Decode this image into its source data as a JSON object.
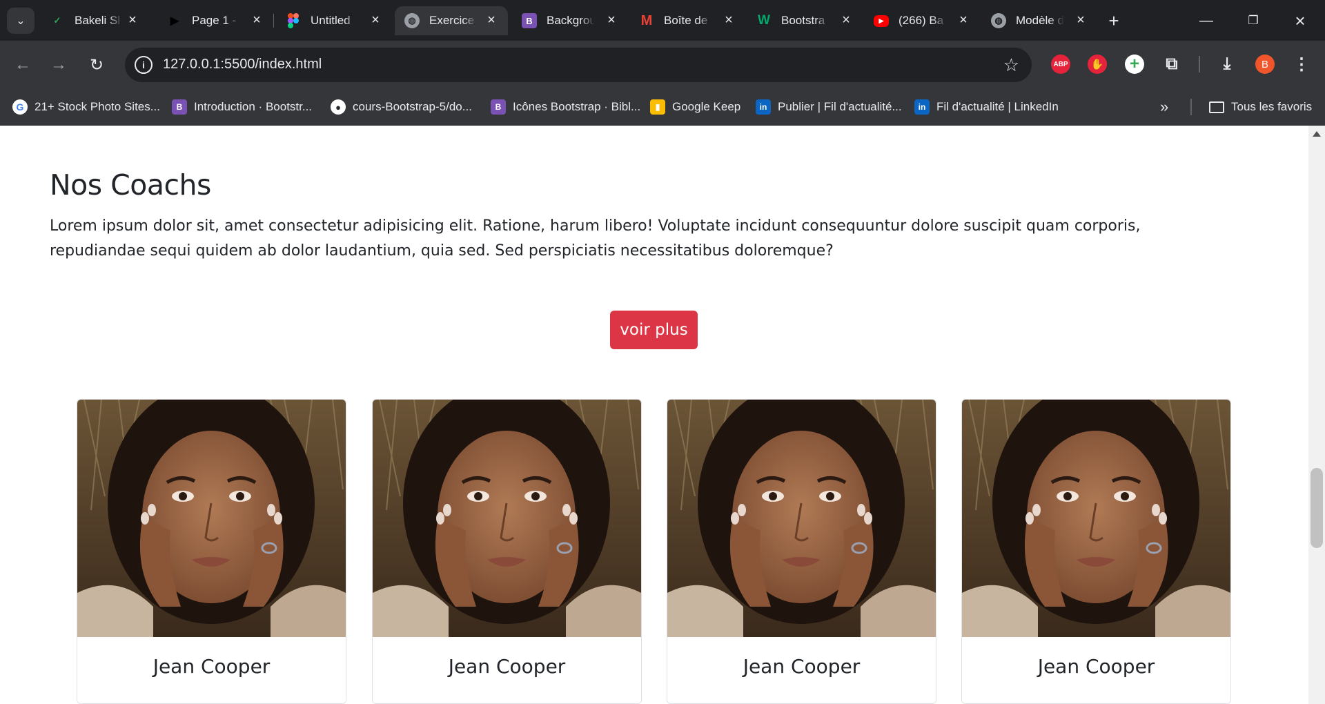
{
  "browser": {
    "tabs": [
      {
        "title": "Bakeli Sl",
        "favicon": "bakeli-icon",
        "color": "#34a853"
      },
      {
        "title": "Page 1 -",
        "favicon": "play-icon",
        "color": "#111111"
      },
      {
        "title": "Untitled",
        "favicon": "figma-icon",
        "color": "#f24e1e"
      },
      {
        "title": "Exercice",
        "favicon": "globe-icon",
        "color": "#9aa0a6",
        "active": true
      },
      {
        "title": "Backgrou",
        "favicon": "bootstrap-icon",
        "color": "#7952b3"
      },
      {
        "title": "Boîte de",
        "favicon": "gmail-icon",
        "color": "#ea4335"
      },
      {
        "title": "Bootstra",
        "favicon": "w3-icon",
        "color": "#04aa6d"
      },
      {
        "title": "(266) Ba",
        "favicon": "youtube-icon",
        "color": "#ff0000"
      },
      {
        "title": "Modèle d",
        "favicon": "globe-icon",
        "color": "#9aa0a6"
      }
    ],
    "url": "127.0.0.1:5500/index.html",
    "profile_initial": "B",
    "extensions": [
      {
        "name": "adblock-plus-icon",
        "label": "ABP",
        "color": "#e5243b"
      },
      {
        "name": "adblock-icon",
        "label": "✋",
        "color": "#e5243b"
      },
      {
        "name": "add-extension-icon",
        "label": "+",
        "color": "#ffffff"
      }
    ],
    "bookmarks": [
      {
        "label": "21+ Stock Photo Sites...",
        "icon": "google-icon",
        "color": "#ffffff"
      },
      {
        "label": "Introduction · Bootstr...",
        "icon": "bootstrap-icon",
        "color": "#7952b3"
      },
      {
        "label": "cours-Bootstrap-5/do...",
        "icon": "github-icon",
        "color": "#ffffff"
      },
      {
        "label": "Icônes Bootstrap · Bibl...",
        "icon": "bootstrap-icon",
        "color": "#7952b3"
      },
      {
        "label": "Google Keep",
        "icon": "keep-icon",
        "color": "#fbbc04"
      },
      {
        "label": "Publier | Fil d'actualité...",
        "icon": "linkedin-icon",
        "color": "#0a66c2"
      },
      {
        "label": "Fil d'actualité | LinkedIn",
        "icon": "linkedin-icon",
        "color": "#0a66c2"
      }
    ],
    "all_bookmarks_label": "Tous les favoris"
  },
  "page": {
    "heading": "Nos Coachs",
    "lead": "Lorem ipsum dolor sit, amet consectetur adipisicing elit. Ratione, harum libero! Voluptate incidunt consequuntur dolore suscipit quam corporis, repudiandae sequi quidem ab dolor laudantium, quia sed. Sed perspiciatis necessitatibus doloremque?",
    "button_label": "voir plus",
    "button_color": "#dc3545",
    "coaches": [
      {
        "name": "Jean Cooper"
      },
      {
        "name": "Jean Cooper"
      },
      {
        "name": "Jean Cooper"
      },
      {
        "name": "Jean Cooper"
      }
    ]
  }
}
